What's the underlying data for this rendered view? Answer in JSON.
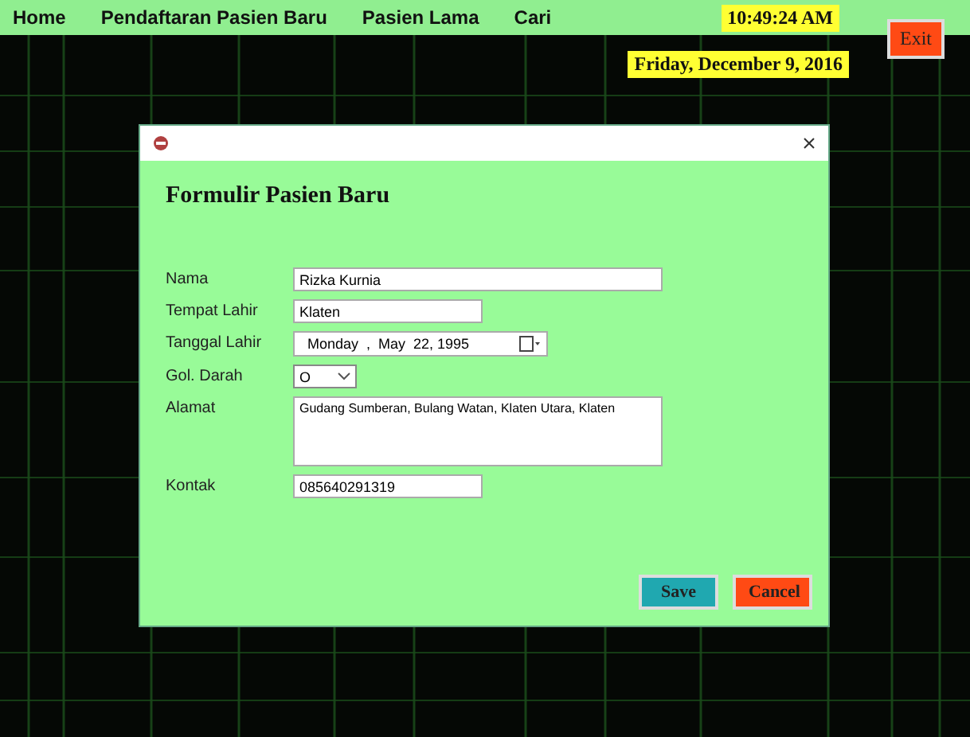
{
  "menu": [
    {
      "label": "Home"
    },
    {
      "label": "Pendaftaran Pasien Baru"
    },
    {
      "label": "Pasien Lama"
    },
    {
      "label": "Cari"
    }
  ],
  "clock": "10:49:24 AM",
  "date": "Friday, December 9, 2016",
  "exit_button": "Exit",
  "dialog": {
    "heading": "Formulir Pasien Baru",
    "fields": [
      {
        "kind": "text",
        "label": "Nama",
        "value": "Rizka Kurnia",
        "wide": true
      },
      {
        "kind": "text",
        "label": "Tempat Lahir",
        "value": "Klaten",
        "wide": false
      },
      {
        "kind": "date",
        "label": "Tanggal Lahir",
        "value": "Monday  ,  May  22, 1995"
      },
      {
        "kind": "select",
        "label": "Gol. Darah",
        "value": "O"
      },
      {
        "kind": "textarea",
        "label": "Alamat",
        "value": "Gudang Sumberan, Bulang Watan, Klaten Utara, Klaten"
      },
      {
        "kind": "text",
        "label": "Kontak",
        "value": "085640291319",
        "wide": false
      }
    ],
    "buttons": [
      {
        "kind": "save",
        "label": "Save"
      },
      {
        "kind": "cancel",
        "label": "Cancel"
      }
    ]
  }
}
